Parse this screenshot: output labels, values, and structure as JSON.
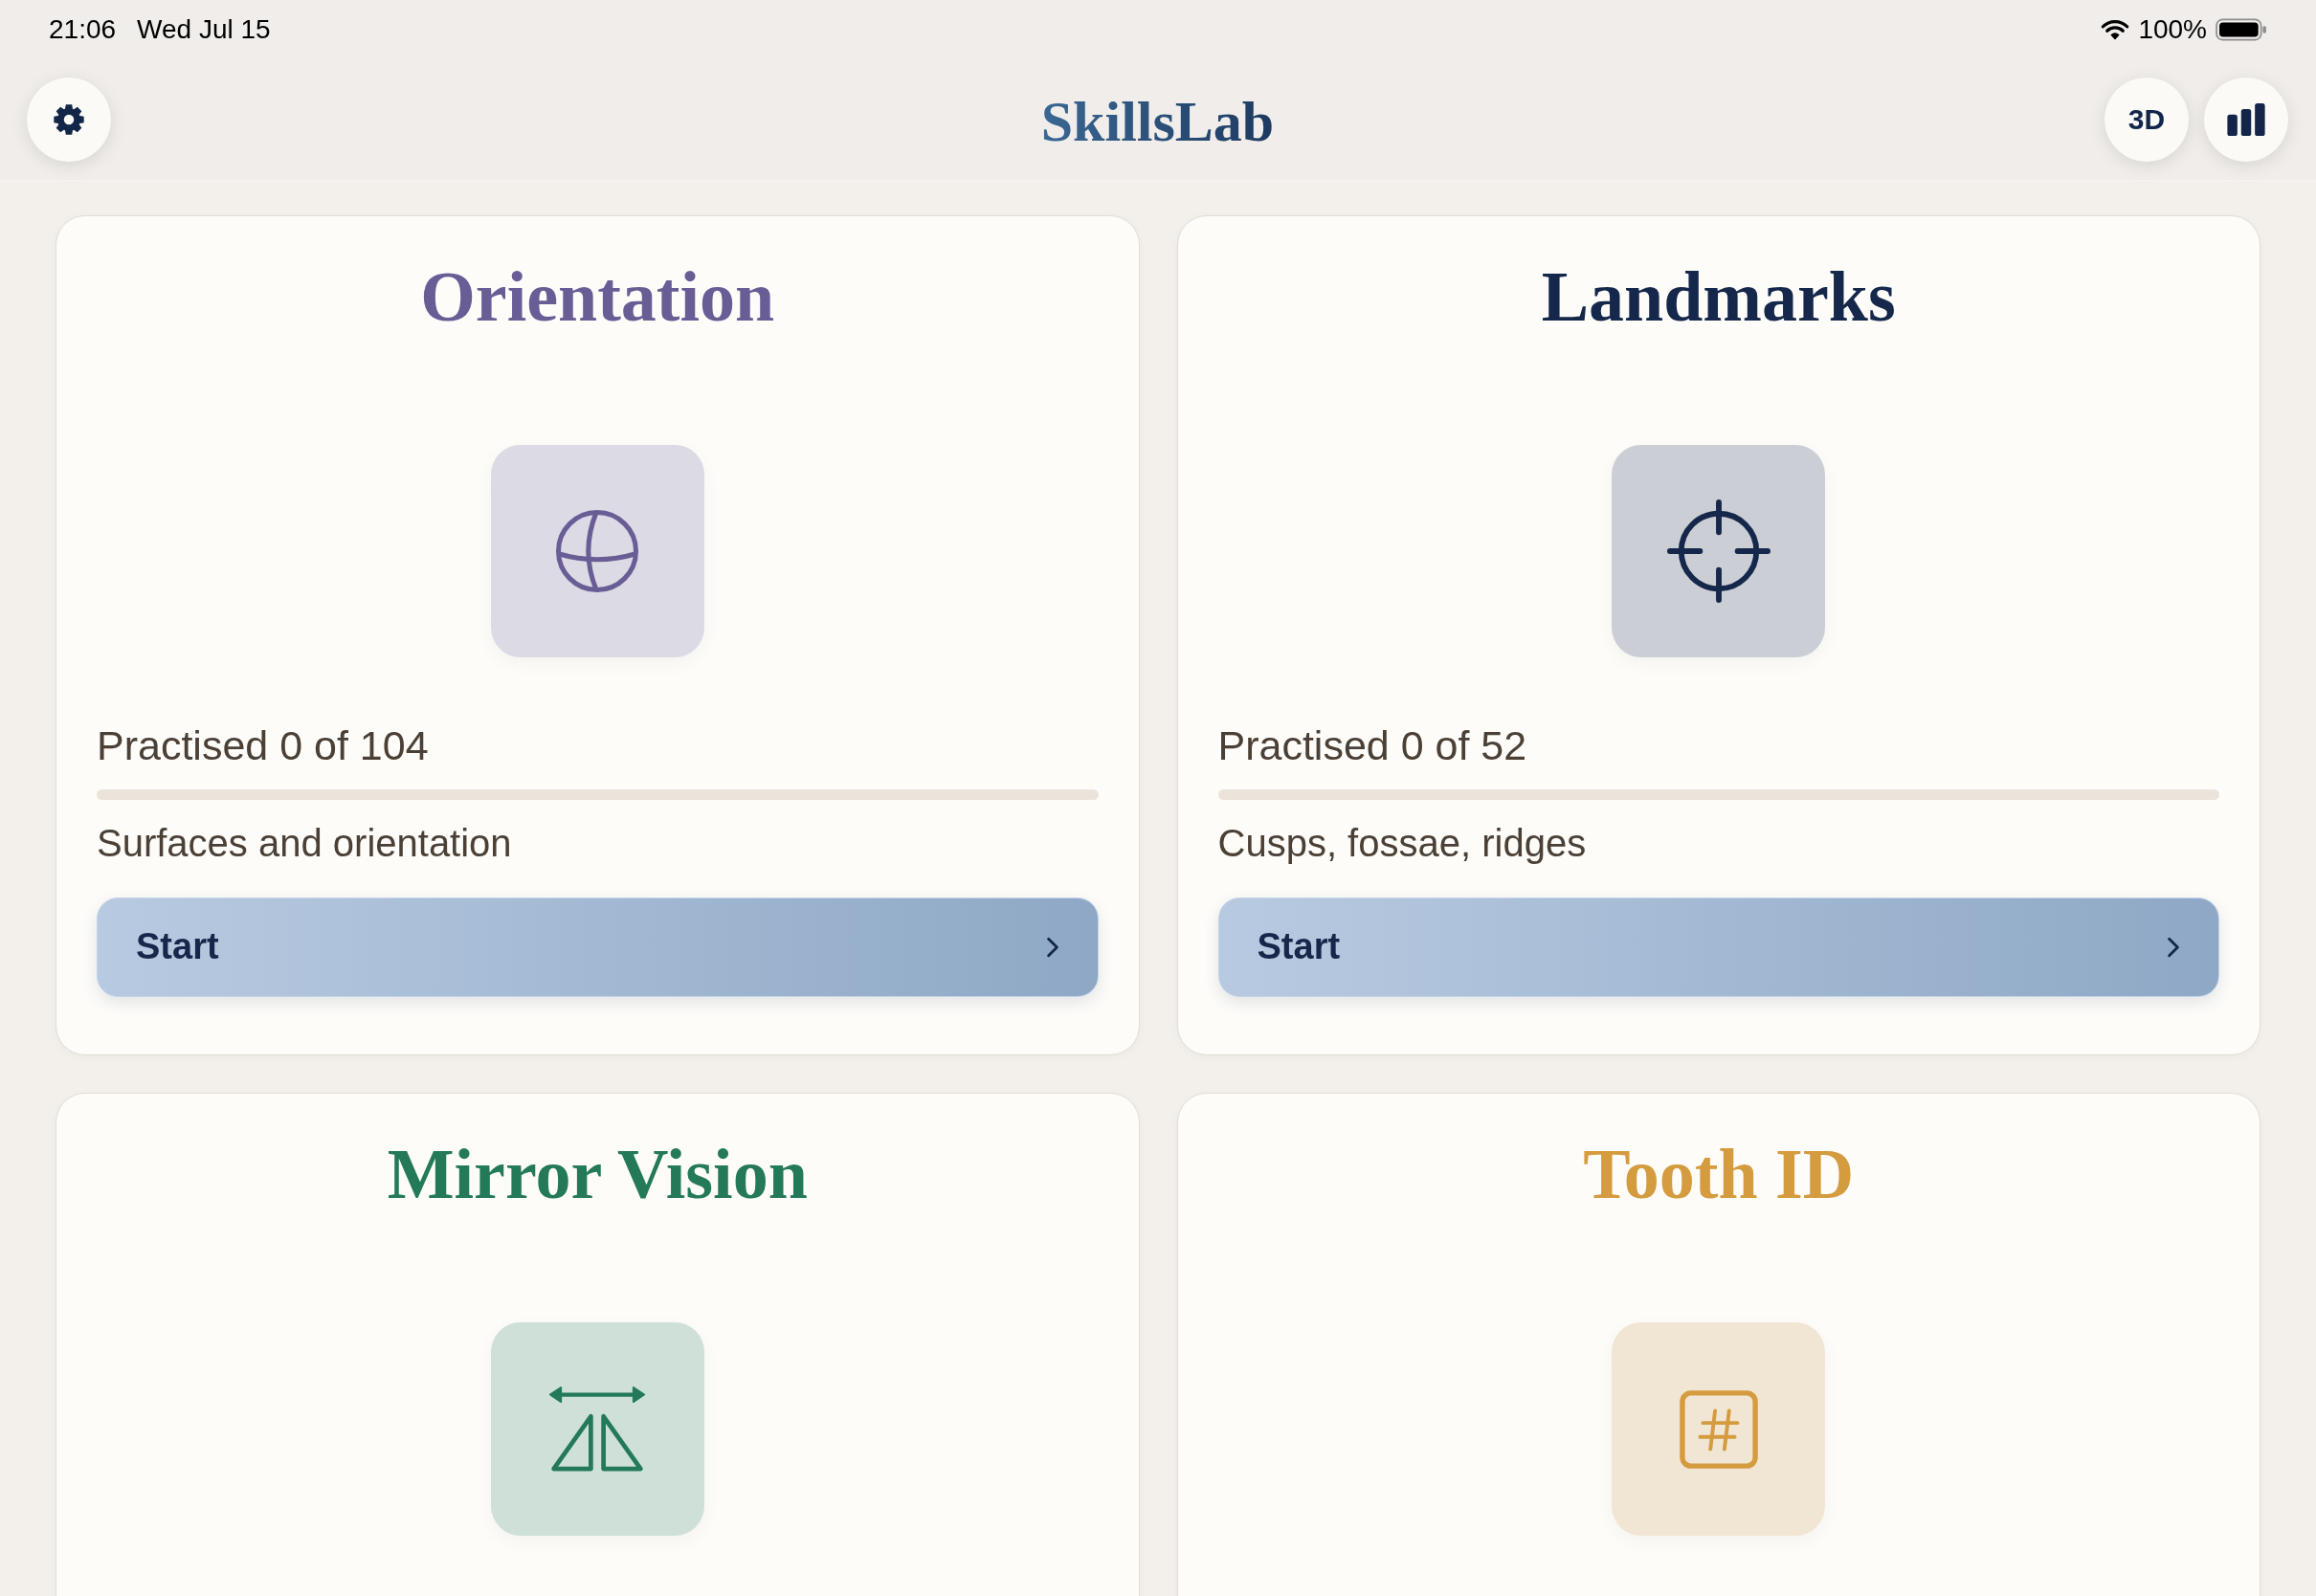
{
  "status_bar": {
    "time": "21:06",
    "date": "Wed Jul 15",
    "battery": "100%"
  },
  "header": {
    "title": "SkillsLab",
    "view_button": "3D"
  },
  "cards": [
    {
      "title": "Orientation",
      "color": "#6a5d96",
      "practised": "Practised 0 of 104",
      "level": 0,
      "subtitle": "Surfaces and orientation",
      "button": "Start"
    },
    {
      "title": "Landmarks",
      "color": "#15284b",
      "practised": "Practised 0 of 52",
      "level": 0,
      "subtitle": "Cusps, fossae, ridges",
      "button": "Start"
    },
    {
      "title": "Mirror Vision",
      "color": "#247a58"
    },
    {
      "title": "Tooth ID",
      "color": "#d59b3f"
    }
  ]
}
